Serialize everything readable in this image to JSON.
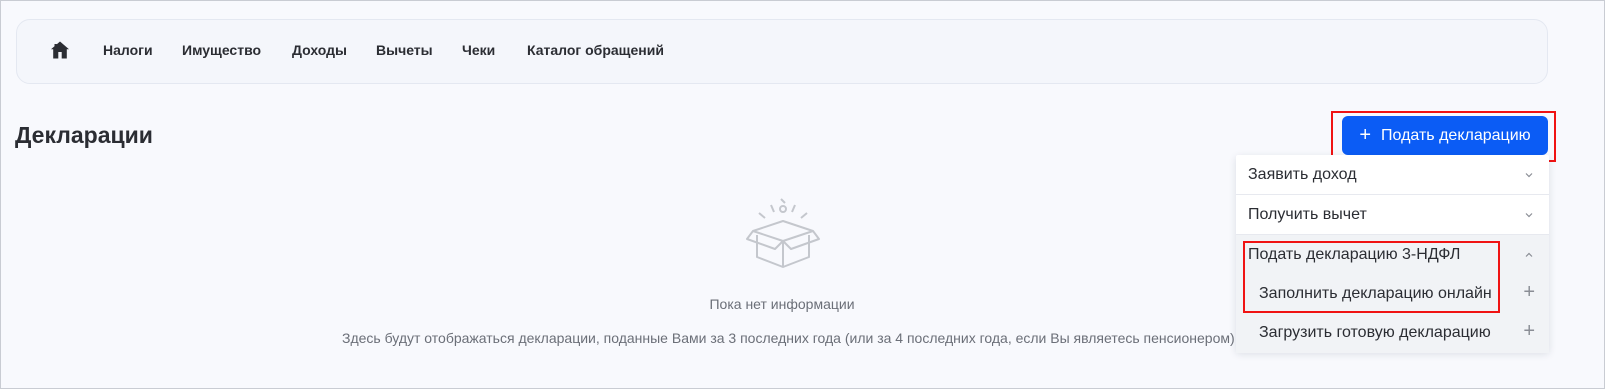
{
  "nav": {
    "home_icon": "home-icon",
    "items": [
      {
        "label": "Налоги"
      },
      {
        "label": "Имущество"
      },
      {
        "label": "Доходы"
      },
      {
        "label": "Вычеты"
      },
      {
        "label": "Чеки"
      },
      {
        "label": "Каталог обращений"
      }
    ]
  },
  "page": {
    "title": "Декларации"
  },
  "submit_button": {
    "icon": "plus-icon",
    "label": "Подать декларацию"
  },
  "dropdown": {
    "items": [
      {
        "label": "Заявить доход",
        "icon": "chevron-down-icon"
      },
      {
        "label": "Получить вычет",
        "icon": "chevron-down-icon"
      },
      {
        "label": "Подать декларацию 3-НДФЛ",
        "icon": "chevron-up-icon",
        "expanded": true,
        "children": [
          {
            "label": "Заполнить декларацию онлайн",
            "icon": "plus-icon"
          },
          {
            "label": "Загрузить готовую декларацию",
            "icon": "plus-icon"
          }
        ]
      }
    ]
  },
  "empty_state": {
    "icon": "empty-box-icon",
    "title": "Пока нет информации",
    "description": "Здесь будут отображаться декларации, поданные Вами за 3 последних года (или за 4 последних года, если Вы являетесь пенсионером)"
  },
  "colors": {
    "accent": "#0b5cf5",
    "highlight": "#f01313",
    "background": "#f8f9fd"
  }
}
